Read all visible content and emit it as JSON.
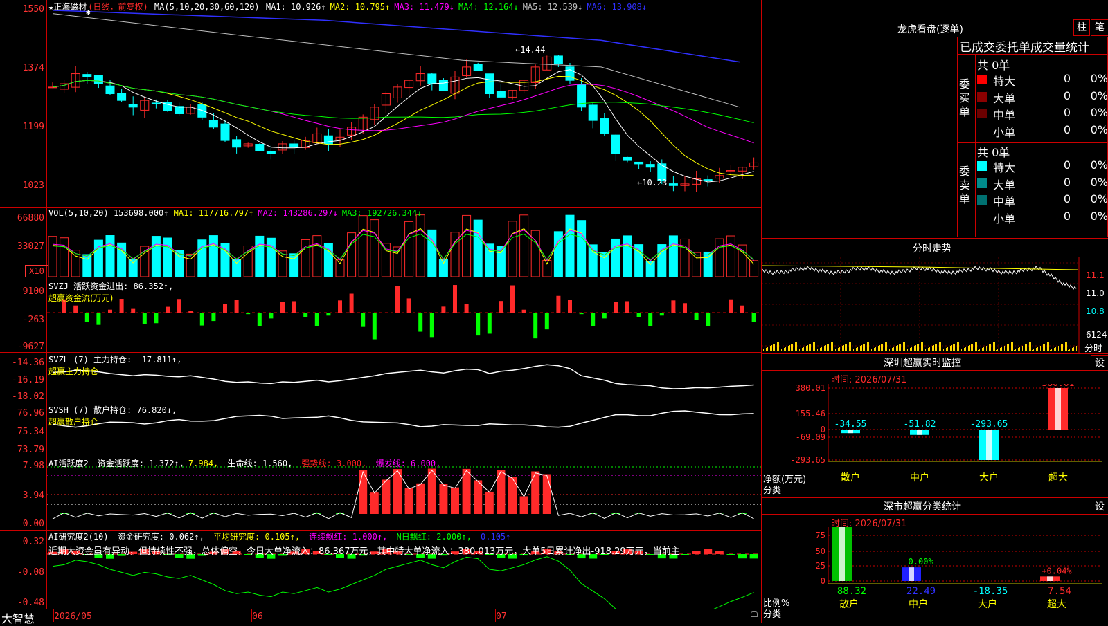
{
  "app": {
    "logo": "大智慧"
  },
  "colors": {
    "up": "#ff2a2a",
    "down": "#00ffff",
    "vol_down": "#00ffff",
    "ma1": "#ffffff",
    "ma2": "#ffff00",
    "ma3": "#ff00ff",
    "ma4": "#00ff00",
    "ma5": "#c0c0c0",
    "ma6": "#0000ff",
    "border": "#c00000"
  },
  "main": {
    "stock_name": "★正海磁材",
    "period": "(日线，前复权)",
    "ma_label": "MA(5,10,20,30,60,120)",
    "ma": [
      {
        "label": "MA1: 10.926↑",
        "color": "#ffffff"
      },
      {
        "label": "MA2: 10.795↑",
        "color": "#ffff00"
      },
      {
        "label": "MA3: 11.479↓",
        "color": "#ff00ff"
      },
      {
        "label": "MA4: 12.164↓",
        "color": "#00ff00"
      },
      {
        "label": "MA5: 12.539↓",
        "color": "#c0c0c0"
      },
      {
        "label": "MA6: 13.908↓",
        "color": "#3030ff"
      }
    ],
    "y_ticks": [
      "1550",
      "1374",
      "1199",
      "1023"
    ],
    "high_mark": "14.44",
    "low_mark": "10.23"
  },
  "vol": {
    "label": "VOL(5,10,20)",
    "value": "153698.000↑",
    "ma": [
      {
        "label": "MA1: 117716.797↑",
        "color": "#ffff00"
      },
      {
        "label": "MA2: 143286.297↓",
        "color": "#ff00ff"
      },
      {
        "label": "MA3: 192726.344↓",
        "color": "#00ff00"
      }
    ],
    "y_ticks": [
      "66880",
      "33027"
    ],
    "unit": "X10"
  },
  "svzj": {
    "label": "SVZJ  活跃资金进出: 86.352↑,",
    "sub": "超赢资金流(万元)",
    "y_ticks": [
      "9100",
      "-263",
      "-9627"
    ]
  },
  "svzl": {
    "label": "SVZL (7) 主力持仓: -17.811↑,",
    "sub": "超赢主力持仓",
    "y_ticks": [
      "-14.36",
      "-16.19",
      "-18.02"
    ]
  },
  "svsh": {
    "label": "SVSH (7) 散户持仓: 76.820↓,",
    "sub": "超赢散户持仓",
    "y_ticks": [
      "76.96",
      "75.34",
      "73.79"
    ]
  },
  "ai1": {
    "items": [
      {
        "text": "AI活跃度2",
        "color": "#ffffff"
      },
      {
        "text": " 资金活跃度: 1.372↑,",
        "color": "#ffffff"
      },
      {
        "text": "7.984,",
        "color": "#ffff00"
      },
      {
        "text": " 生命线: 1.560,",
        "color": "#ffffff"
      },
      {
        "text": " 强势线: 3.000,",
        "color": "#ff2020"
      },
      {
        "text": " 爆发线: 6.000,",
        "color": "#ff00ff"
      }
    ],
    "y_ticks": [
      "7.98",
      "3.94",
      "0.00"
    ]
  },
  "ai2": {
    "items": [
      {
        "text": "AI研究度2(10)",
        "color": "#ffffff"
      },
      {
        "text": " 资金研究度: 0.062↑,",
        "color": "#ffffff"
      },
      {
        "text": " 平均研究度: 0.105↑,",
        "color": "#ffff00"
      },
      {
        "text": " 连续飘红: 1.000↑,",
        "color": "#ff00ff"
      },
      {
        "text": " N日飘红: 2.000↑,",
        "color": "#00ff00"
      },
      {
        "text": " 0.105↑",
        "color": "#3030ff"
      }
    ],
    "comment": "近期大资金虽有异动，但持续性不强，总体偏空，今日大单净流入：86.367万元，其中特大单净流入：380.013万元，大单5日累计净出-918.29万元，当前主",
    "y_ticks": [
      "0.32",
      "-0.08",
      "-0.48"
    ]
  },
  "xaxis": {
    "labels": [
      "2026/05",
      "06",
      "07"
    ]
  },
  "right": {
    "lh_title": "龙虎看盘(逐单)",
    "btn1": "柱",
    "btn2": "笔",
    "lh_subtitle": "已成交委托单成交量统计",
    "buy": {
      "side": "委买单",
      "total": "共 0单",
      "rows": [
        {
          "name": "特大",
          "v": "0",
          "p": "0%",
          "color": "#ff0000"
        },
        {
          "name": "大单",
          "v": "0",
          "p": "0%",
          "color": "#8b0000"
        },
        {
          "name": "中单",
          "v": "0",
          "p": "0%",
          "color": "#6b0000"
        },
        {
          "name": "小单",
          "v": "0",
          "p": "0%",
          "color": ""
        }
      ]
    },
    "sell": {
      "side": "委卖单",
      "total": "共 0单",
      "rows": [
        {
          "name": "特大",
          "v": "0",
          "p": "0%",
          "color": "#00ffff"
        },
        {
          "name": "大单",
          "v": "0",
          "p": "0%",
          "color": "#008b8b"
        },
        {
          "name": "中单",
          "v": "0",
          "p": "0%",
          "color": "#007070"
        },
        {
          "name": "小单",
          "v": "0",
          "p": "0%",
          "color": ""
        }
      ]
    },
    "fs_title": "分时走势",
    "fs_y": [
      "11.1",
      "11.0",
      "10.8"
    ],
    "fs_vol": "6124",
    "fs_vol_label": "分时",
    "sz_title": "深圳超赢实时监控",
    "sz_btn": "设",
    "sz_time": "时间: 2026/07/31",
    "sz_y": [
      "380.01",
      "155.46",
      "0",
      "-69.09",
      "-293.65"
    ],
    "sz_ylabel": "净额(万元)",
    "sz_xlabel": "分类",
    "sz_bars": [
      {
        "cat": "散户",
        "value": -34.55,
        "label": "-34.55",
        "color": "#00ffff"
      },
      {
        "cat": "中户",
        "value": -51.82,
        "label": "-51.82",
        "color": "#00ffff"
      },
      {
        "cat": "大户",
        "value": -293.65,
        "label": "-293.65",
        "color": "#00ffff"
      },
      {
        "cat": "超大",
        "value": 380.01,
        "label": "380.01",
        "color": "#ff2a2a"
      }
    ],
    "ss_title": "深市超赢分类统计",
    "ss_btn": "设",
    "ss_time": "时间: 2026/07/31",
    "ss_y": [
      "75",
      "50",
      "25",
      "0"
    ],
    "ss_ylabel": "比例%",
    "ss_xlabel": "分类",
    "ss_bars": [
      {
        "cat": "散户",
        "value": 88.32,
        "label": "88.32",
        "top": "-0.00%",
        "topcolor": "#00ff00",
        "fill": "#00c000",
        "valcolor": "#00ff00"
      },
      {
        "cat": "中户",
        "value": 22.49,
        "label": "22.49",
        "top": "-0.00%",
        "topcolor": "#00ff00",
        "fill": "#2020ff",
        "valcolor": "#3030ff"
      },
      {
        "cat": "大户",
        "value": -18.35,
        "label": "-18.35",
        "top": "",
        "topcolor": "#00ff00",
        "fill": "#00ffff",
        "valcolor": "#00ffff"
      },
      {
        "cat": "超大",
        "value": 7.54,
        "label": "7.54",
        "top": "+0.04%",
        "topcolor": "#ff2a2a",
        "fill": "#ff2a2a",
        "valcolor": "#ff2a2a"
      }
    ]
  }
}
